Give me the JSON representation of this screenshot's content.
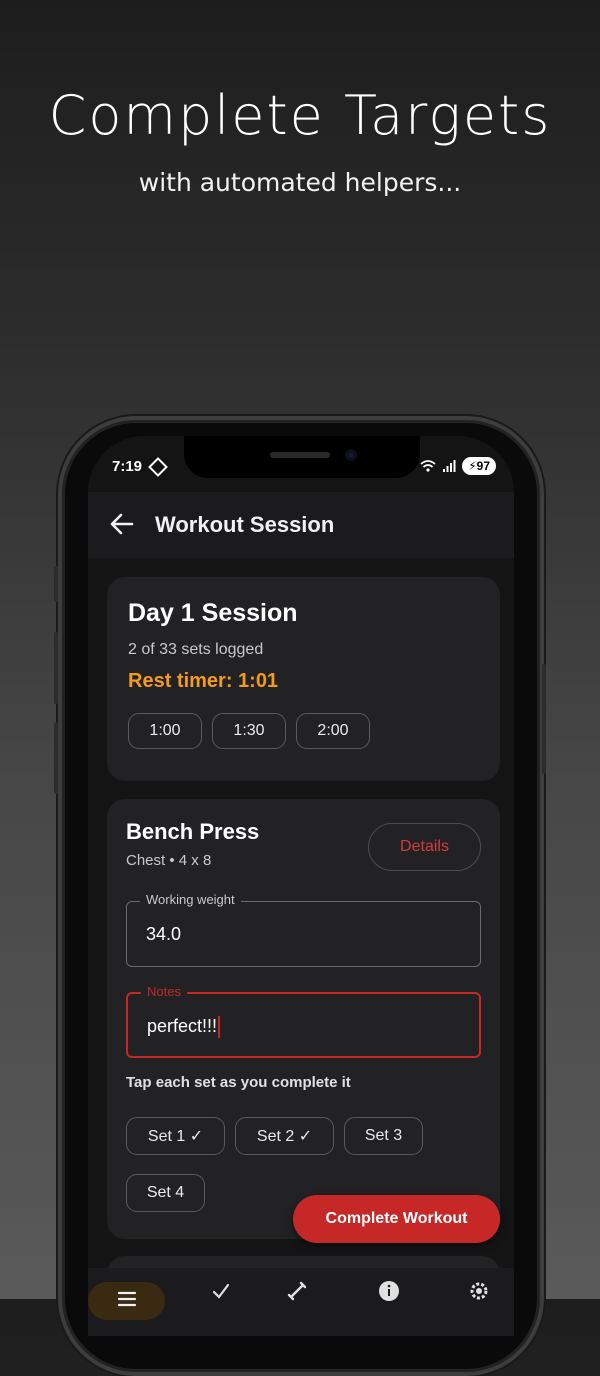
{
  "hero": {
    "title": "Complete Targets",
    "subtitle": "with automated helpers..."
  },
  "status_bar": {
    "time": "7:19",
    "battery": "97"
  },
  "app_bar": {
    "title": "Workout Session"
  },
  "session": {
    "title": "Day 1 Session",
    "sets_logged": "2 of 33 sets logged",
    "rest_timer": "Rest timer: 1:01",
    "timer_options": [
      "1:00",
      "1:30",
      "2:00"
    ]
  },
  "exercise": {
    "name": "Bench Press",
    "meta": "Chest • 4 x 8",
    "details_label": "Details",
    "weight_label": "Working weight",
    "weight_value": "34.0",
    "notes_label": "Notes",
    "notes_value": "perfect!!!",
    "helper_text": "Tap each set as you complete it",
    "sets": [
      "Set 1 ✓",
      "Set 2 ✓",
      "Set 3",
      "Set 4"
    ]
  },
  "actions": {
    "complete_workout": "Complete Workout"
  },
  "colors": {
    "accent": "#c62828",
    "timer": "#f39a1f",
    "card": "#222225",
    "background": "#141414"
  }
}
